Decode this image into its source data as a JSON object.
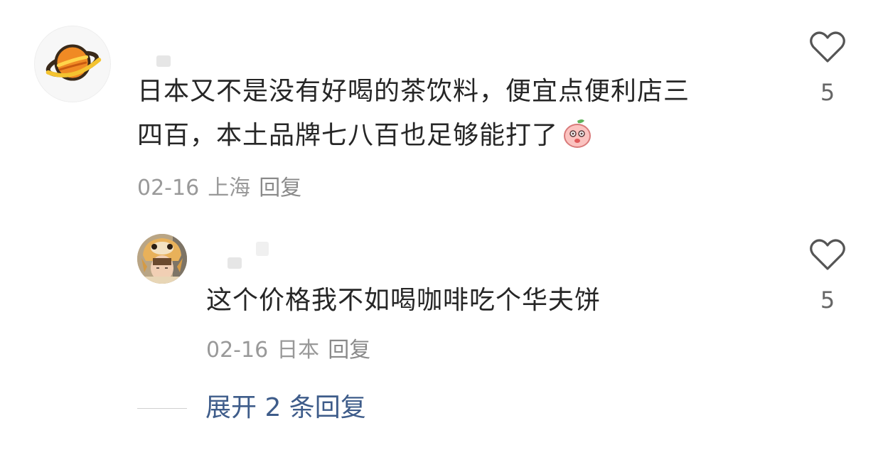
{
  "comments": [
    {
      "text_line1": "日本又不是没有好喝的茶饮料，便宜点便利店三",
      "text_line2": "四百，本土品牌七八百也足够能打了",
      "emoji_icon": "peach-sticker-icon",
      "date": "02-16",
      "location": "上海",
      "reply_label": "回复",
      "like_icon": "heart-outline-icon",
      "likes": "5"
    },
    {
      "text": "这个价格我不如喝咖啡吃个华夫饼",
      "date": "02-16",
      "location": "日本",
      "reply_label": "回复",
      "like_icon": "heart-outline-icon",
      "likes": "5"
    }
  ],
  "expand_replies_label": "展开 2 条回复",
  "colors": {
    "text": "#262626",
    "meta": "#999999",
    "link": "#3e5c8a",
    "planet_orange": "#f08a24"
  }
}
